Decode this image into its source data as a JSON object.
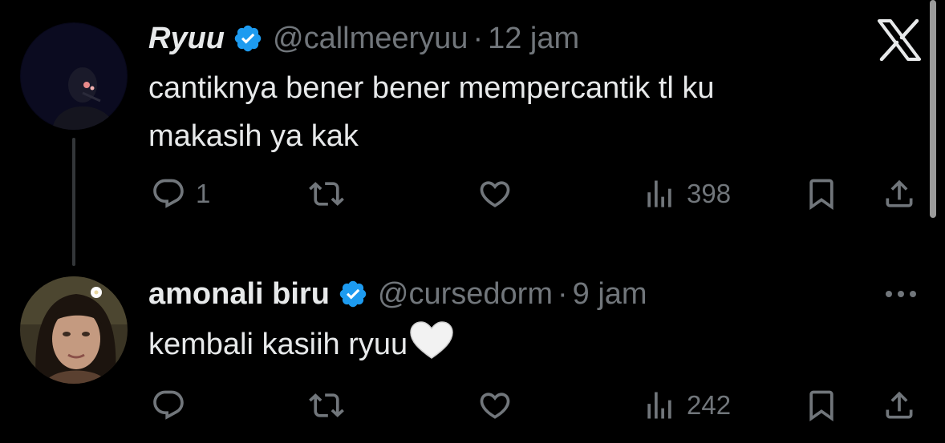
{
  "app": {
    "logo_icon": "x-logo-icon"
  },
  "colors": {
    "background": "#000000",
    "text": "#e7e9ea",
    "muted": "#71767b",
    "verified": "#1d9bf0"
  },
  "tweets": [
    {
      "name": "Ryuu",
      "handle": "@callmeeryuu",
      "separator": "·",
      "time": "12 jam",
      "text_line1": "cantiknya bener bener mempercantik tl ku",
      "text_line2": "makasih ya kak",
      "replies": "1",
      "retweets": "",
      "likes": "",
      "views": "398"
    },
    {
      "name": "amonali biru",
      "handle": "@cursedorm",
      "separator": "·",
      "time": "9 jam",
      "text": "kembali kasiih ryuu",
      "emoji": "white-heart",
      "replies": "",
      "retweets": "",
      "likes": "",
      "views": "242"
    }
  ]
}
